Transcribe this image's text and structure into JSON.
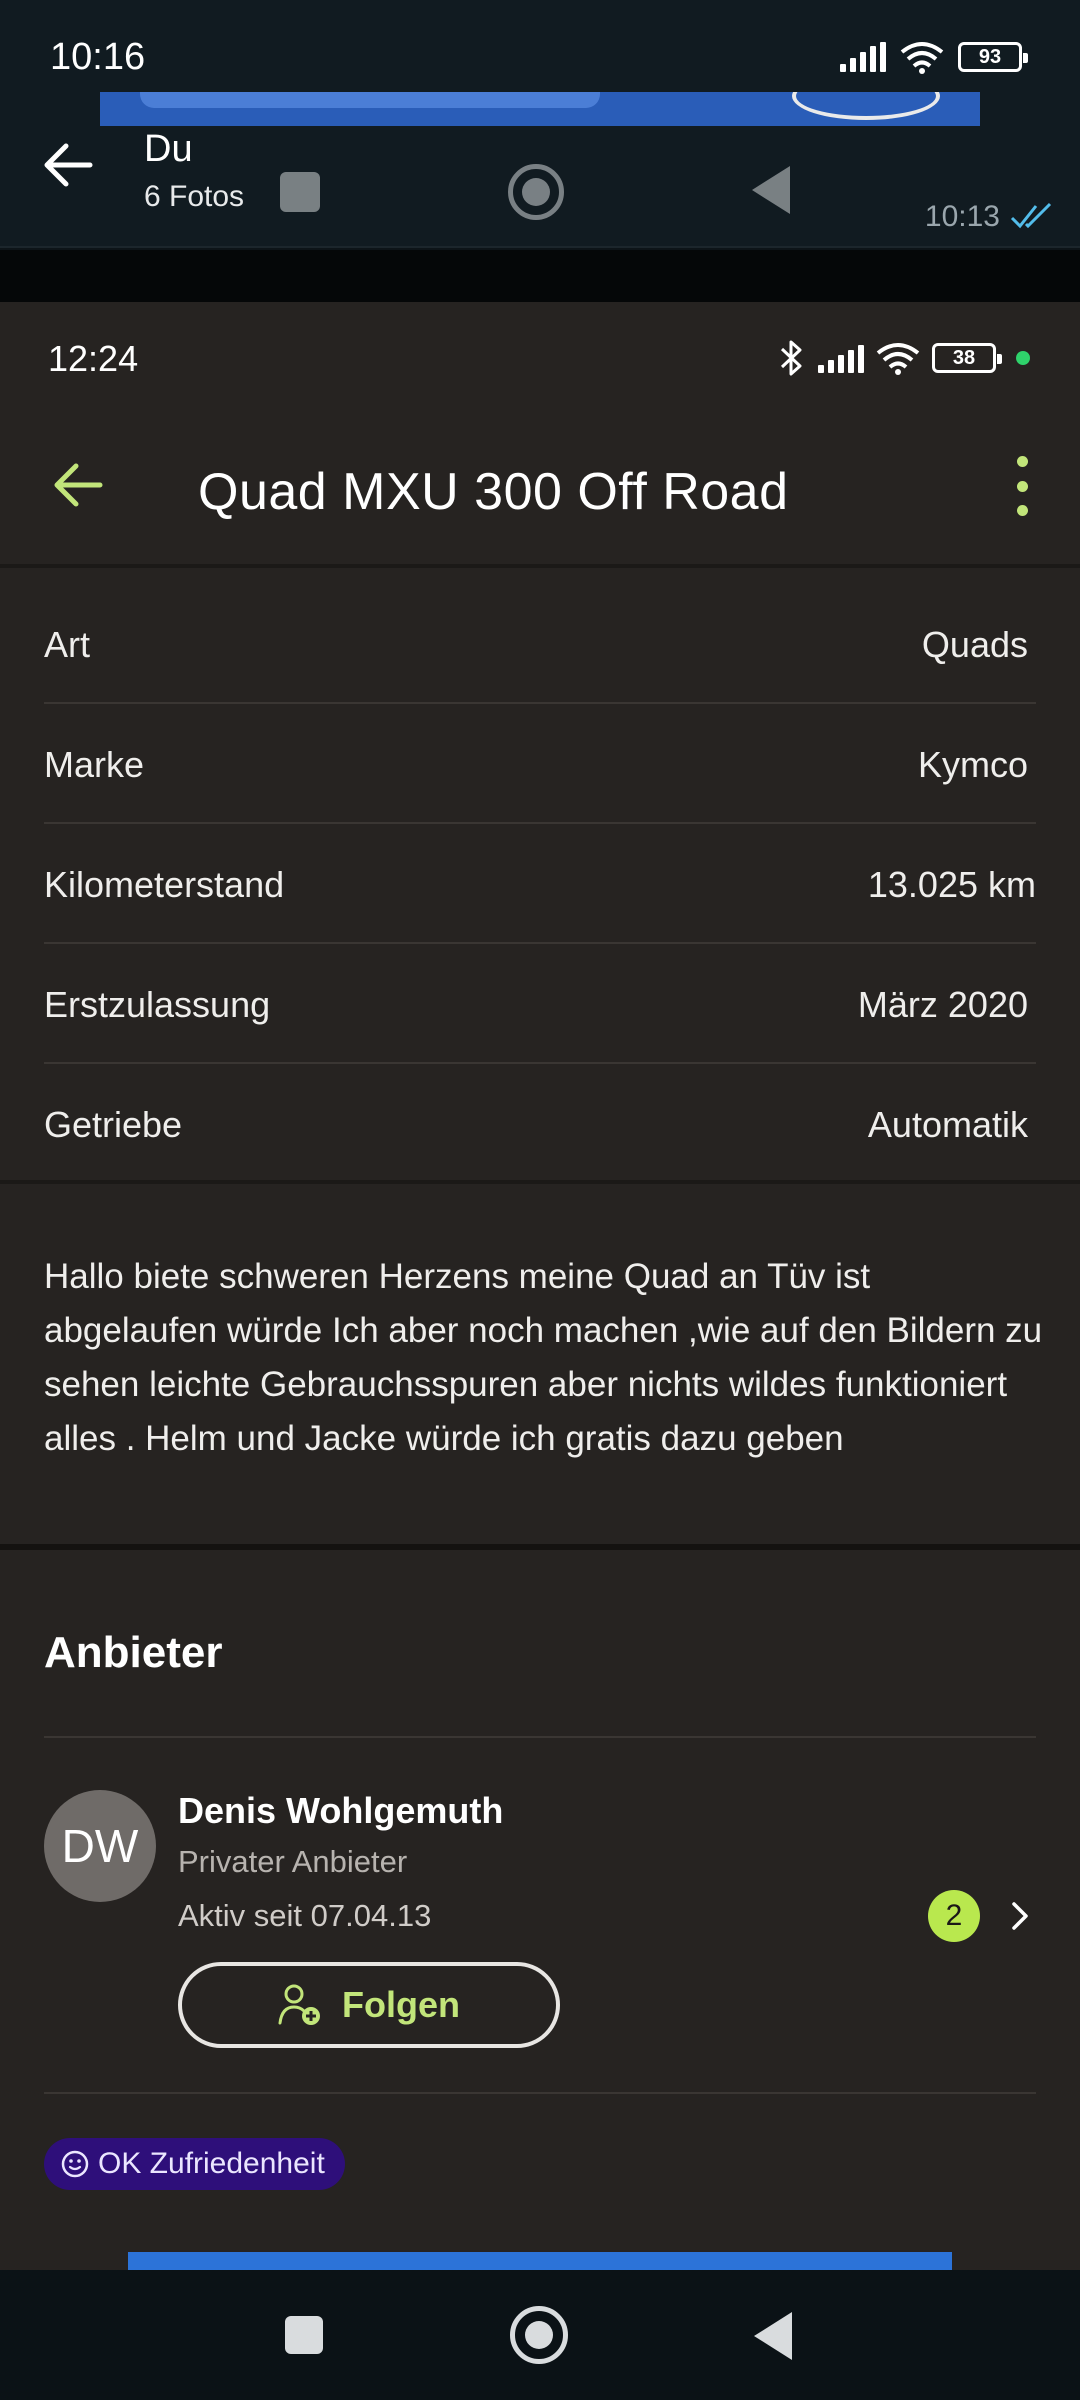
{
  "outer": {
    "status_time": "10:16",
    "battery": "93",
    "chat_title": "Du",
    "chat_subtitle": "6 Fotos",
    "message_time": "10:13"
  },
  "inner": {
    "status_time": "12:24",
    "battery": "38",
    "title": "Quad MXU 300 Off Road",
    "details": [
      {
        "label": "Art",
        "value": "Quads"
      },
      {
        "label": "Marke",
        "value": "Kymco"
      },
      {
        "label": "Kilometerstand",
        "value": "13.025 km"
      },
      {
        "label": "Erstzulassung",
        "value": "März 2020"
      },
      {
        "label": "Getriebe",
        "value": "Automatik"
      }
    ],
    "description": "Hallo biete schweren Herzens meine Quad an Tüv ist abgelaufen würde Ich aber noch machen ,wie auf den Bildern zu sehen leichte Gebrauchsspuren aber nichts wildes funktioniert alles . Helm und Jacke würde ich gratis dazu geben",
    "seller": {
      "heading": "Anbieter",
      "initials": "DW",
      "name": "Denis Wohlgemuth",
      "type": "Privater Anbieter",
      "active_since": "Aktiv seit 07.04.13",
      "listing_count": "2",
      "follow_label": "Folgen",
      "satisfaction_label": "OK Zufriedenheit"
    }
  },
  "colors": {
    "accent": "#c2e57a",
    "badge_green": "#b9e84e",
    "satisfaction_bg": "#2e0f7a",
    "inner_bg": "#262321",
    "outer_bg": "#111b21"
  },
  "icons": [
    "back-arrow-icon",
    "signal-icon",
    "wifi-icon",
    "battery-icon",
    "bluetooth-icon",
    "more-vert-icon",
    "add-person-icon",
    "chevron-right-icon",
    "smiley-icon",
    "double-check-icon"
  ]
}
